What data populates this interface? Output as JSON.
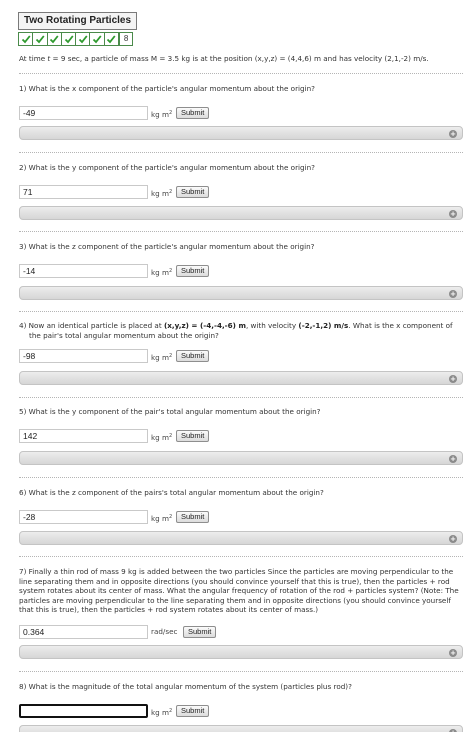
{
  "title": "Two Rotating Particles",
  "progress": {
    "completed": 7,
    "count_label": "8"
  },
  "intro": "At time t = 9 sec, a particle of mass M = 3.5 kg is at the position (x,y,z) = (4,4,6) m and has velocity (2,1,-2) m/s.",
  "questions": [
    {
      "text": "1) What is the x component of the particle's angular momentum about the origin?",
      "answer": "-49",
      "unit": "kg m",
      "unit_sup": "2"
    },
    {
      "text": "2) What is the y component of the particle's angular momentum about the origin?",
      "answer": "71",
      "unit": "kg m",
      "unit_sup": "2"
    },
    {
      "text": "3) What is the z component of the particle's angular momentum about the origin?",
      "answer": "-14",
      "unit": "kg m",
      "unit_sup": "2"
    },
    {
      "text_pre": "4) Now an identical particle is placed at ",
      "text_pos": "(x,y,z) = (-4,-4,-6) m",
      "text_mid": ", with velocity ",
      "text_vel": "(-2,-1,2) m/s",
      "text_post": ". What is the x component of the pair's total angular momentum about the origin?",
      "answer": "-98",
      "unit": "kg m",
      "unit_sup": "2"
    },
    {
      "text": "5) What is the y component of the pair's total angular momentum about the origin?",
      "answer": "142",
      "unit": "kg m",
      "unit_sup": "2"
    },
    {
      "text": "6) What is the z component of the pairs's total angular momentum about the origin?",
      "answer": "-28",
      "unit": "kg m",
      "unit_sup": "2"
    },
    {
      "text": "7) Finally a thin rod of mass 9 kg is added between the two particles Since the particles are moving perpendicular to the line separating them and in opposite directions (you should convince yourself that this is true), then the particles + rod system rotates about its center of mass. What the angular frequency of rotation of the rod + particles system? (Note: The particles are moving perpendicular to the line separating them and in opposite directions (you should convince yourself that this is true), then the particles + rod system rotates about its center of mass.)",
      "answer": "0.364",
      "unit": "rad/sec",
      "unit_sup": ""
    },
    {
      "text": "8) What is the magnitude of the total angular momentum of the system (particles plus rod)?",
      "answer": "",
      "unit": "kg m",
      "unit_sup": "2"
    }
  ],
  "submit_label": "Submit",
  "hint_icon": "plus-circle-icon"
}
